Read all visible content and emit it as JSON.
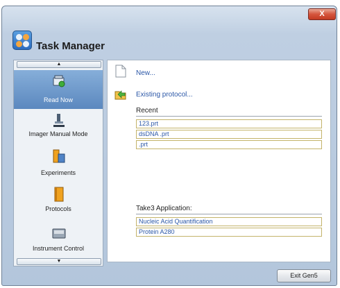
{
  "window": {
    "close_glyph": "X"
  },
  "header": {
    "title": "Task Manager",
    "logo_icon": "gen5-logo-icon"
  },
  "sidebar": {
    "scroll_up_glyph": "▲",
    "scroll_down_glyph": "▼",
    "selected_color": "#6a95c9",
    "items": [
      {
        "label": "Read Now",
        "icon": "read-now-icon",
        "selected": true
      },
      {
        "label": "Imager Manual Mode",
        "icon": "microscope-icon",
        "selected": false
      },
      {
        "label": "Experiments",
        "icon": "experiments-icon",
        "selected": false
      },
      {
        "label": "Protocols",
        "icon": "protocols-icon",
        "selected": false
      },
      {
        "label": "Instrument Control",
        "icon": "instrument-icon",
        "selected": false
      }
    ]
  },
  "main": {
    "new_label": "New...",
    "existing_label": "Existing protocol...",
    "recent_heading": "Recent",
    "recent_items": [
      "123.prt",
      "dsDNA .prt",
      ".prt"
    ],
    "take3_heading": "Take3 Application:",
    "take3_items": [
      "Nucleic Acid Quantification",
      "Protein A280"
    ]
  },
  "footer": {
    "exit_label": "Exit Gen5"
  }
}
